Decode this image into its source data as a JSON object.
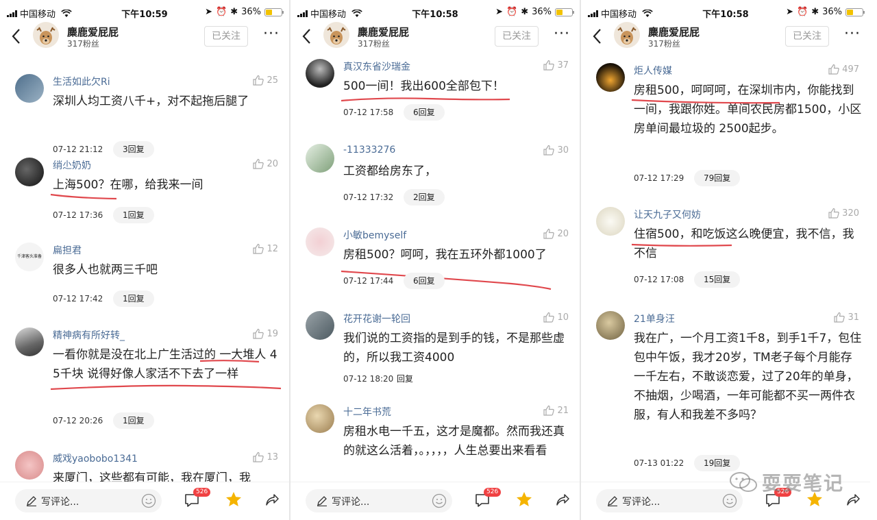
{
  "colors": {
    "accent_link": "#4a6b95",
    "underline": "#e0474c",
    "badge": "#f04142",
    "star": "#f5b400"
  },
  "panels": [
    {
      "status": {
        "carrier": "中国移动",
        "time": "下午10:59",
        "battery": "36%"
      },
      "header": {
        "name": "麋鹿爱屁屁",
        "fans": "317粉丝",
        "follow": "已关注",
        "more": "···"
      },
      "comments": [
        {
          "user": "生活如此欠Ri",
          "likes": "25",
          "text": "深圳人均工资八千+，对不起拖后腿了",
          "time": "07-12 21:12",
          "reply": "3回复",
          "avatar": "photo-blue"
        },
        {
          "user": "绡尐奶奶",
          "likes": "20",
          "text": "上海500？在哪，给我来一间",
          "time": "07-12 17:36",
          "reply": "1回复",
          "avatar": "photo-dark"
        },
        {
          "user": "扁担君",
          "likes": "12",
          "text": "很多人也就两三千吧",
          "time": "07-12 17:42",
          "reply": "1回复",
          "avatar": "avatar-text",
          "avatar_text": "千津客头准备"
        },
        {
          "user": "精神病有所好转_",
          "likes": "19",
          "text": "一看你就是没在北上广生活过的  一大堆人 4 5千块  说得好像人家活不下去了一样",
          "time": "07-12 20:26",
          "reply": "1回复",
          "avatar": "photo-gray"
        },
        {
          "user": "威戏yaobobo1341",
          "likes": "13",
          "text": "来厦门，这些都有可能，我在厦门，我",
          "time": "",
          "reply": "",
          "avatar": "photo-pink"
        }
      ],
      "bottom": {
        "placeholder": "写评论...",
        "comment_count": "526"
      }
    },
    {
      "status": {
        "carrier": "中国移动",
        "time": "下午10:58",
        "battery": "36%"
      },
      "header": {
        "name": "麋鹿爱屁屁",
        "fans": "317粉丝",
        "follow": "已关注",
        "more": "···"
      },
      "comments": [
        {
          "user": "真汉东省沙瑞金",
          "likes": "37",
          "text": "500一间！我出600全部包下！",
          "time": "07-12 17:58",
          "reply": "6回复",
          "avatar": "photo-dark"
        },
        {
          "user": "-11333276",
          "likes": "30",
          "text": "工资都给房东了，",
          "time": "07-12 17:32",
          "reply": "2回复",
          "avatar": "photo-green"
        },
        {
          "user": "小敏bemyself",
          "likes": "20",
          "text": "房租500？呵呵，我在五环外都1000了",
          "time": "07-12 17:44",
          "reply": "6回复",
          "avatar": "photo-pink"
        },
        {
          "user": "花开花谢一轮回",
          "likes": "10",
          "text": "我们说的工资指的是到手的钱，不是那些虚的，所以我工资4000",
          "time": "07-12 18:20",
          "reply": "回复",
          "avatar": "photo-gray"
        },
        {
          "user": "十二年书荒",
          "likes": "21",
          "text": "房租水电一千五，这才是魔都。然而我还真的就这么活着，。，，，，人生总要出来看看",
          "time": "",
          "reply": "",
          "avatar": "photo-tan"
        }
      ],
      "bottom": {
        "placeholder": "写评论...",
        "comment_count": "526"
      }
    },
    {
      "status": {
        "carrier": "中国移动",
        "time": "下午10:58",
        "battery": "36%"
      },
      "header": {
        "name": "麋鹿爱屁屁",
        "fans": "317粉丝",
        "follow": "已关注",
        "more": "···"
      },
      "comments": [
        {
          "user": "炬人传媒",
          "likes": "497",
          "text": "房租500，呵呵呵，在深圳市内，你能找到一间，我跟你姓。单间农民房都1500，小区房单间最垃圾的 2500起步。",
          "time": "07-12 17:29",
          "reply": "79回复",
          "avatar": "photo-orange"
        },
        {
          "user": "让天九子又何妨",
          "likes": "320",
          "text": "住宿500，和吃饭这么晚便宜，我不信，我不信",
          "time": "07-12 17:08",
          "reply": "15回复",
          "avatar": "photo-cat"
        },
        {
          "user": "21单身汪",
          "likes": "31",
          "text": "我在广，一个月工资1千8，到手1千7，包住包中午饭，我才20岁，TM老子每个月能存一千左右，不敢谈恋爱，过了20年的单身，不抽烟，少喝酒，一年可能都不买一两件衣服，有人和我差不多吗？",
          "time": "07-13 01:22",
          "reply": "19回复",
          "avatar": "photo-tan"
        }
      ],
      "bottom": {
        "placeholder": "写评论...",
        "comment_count": "526"
      }
    }
  ],
  "watermark": "耍耍笔记"
}
